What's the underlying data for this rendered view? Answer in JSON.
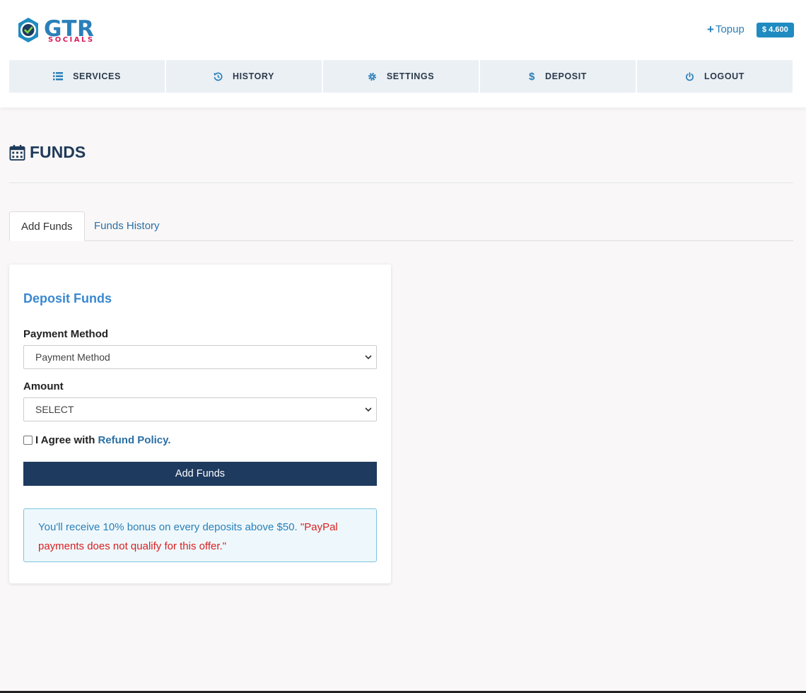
{
  "brand": {
    "name": "GTR",
    "tagline": "SOCIALS"
  },
  "topbar": {
    "topup_label": "Topup",
    "balance": "$ 4.600"
  },
  "nav": [
    {
      "label": "SERVICES",
      "icon": "list-icon"
    },
    {
      "label": "HISTORY",
      "icon": "history-icon"
    },
    {
      "label": "SETTINGS",
      "icon": "gear-icon"
    },
    {
      "label": "DEPOSIT",
      "icon": "dollar-icon"
    },
    {
      "label": "LOGOUT",
      "icon": "power-icon"
    }
  ],
  "page": {
    "title": "FUNDS"
  },
  "tabs": [
    {
      "label": "Add Funds",
      "active": true
    },
    {
      "label": "Funds History",
      "active": false
    }
  ],
  "form": {
    "title": "Deposit Funds",
    "payment_label": "Payment Method",
    "payment_value": "Payment Method",
    "amount_label": "Amount",
    "amount_value": "SELECT",
    "agree_text": "I Agree with",
    "agree_link": "Refund Policy.",
    "submit": "Add Funds"
  },
  "notice": {
    "bonus": "You'll receive 10% bonus on every deposits above $50.",
    "paypal": "\"PayPal payments does not qualify for this offer.\""
  },
  "colors": {
    "accent": "#2a7fb8",
    "button": "#1f3a5f",
    "brand_pink": "#d81f5c",
    "warning": "#d92020"
  }
}
